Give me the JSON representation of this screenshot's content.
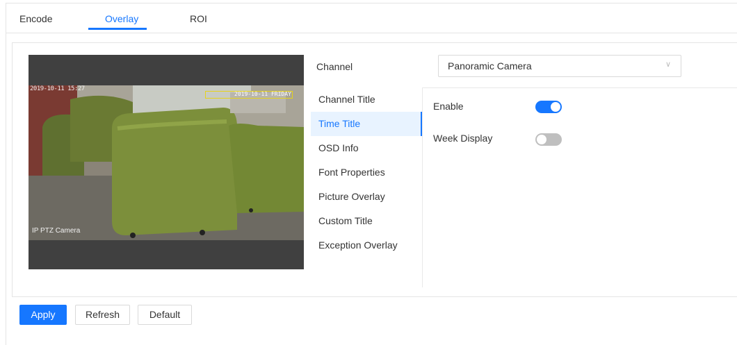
{
  "tabs": [
    {
      "label": "Encode"
    },
    {
      "label": "Overlay"
    },
    {
      "label": "ROI"
    }
  ],
  "video": {
    "osd_time": "2019-10-11 15:27",
    "osd_channel_name": "IP PTZ Camera",
    "roi_text": "2019-10-11 FRIDAY"
  },
  "channel": {
    "label": "Channel",
    "selected": "Panoramic Camera"
  },
  "menu": {
    "items": [
      {
        "label": "Channel Title"
      },
      {
        "label": "Time Title"
      },
      {
        "label": "OSD Info"
      },
      {
        "label": "Font Properties"
      },
      {
        "label": "Picture Overlay"
      },
      {
        "label": "Custom Title"
      },
      {
        "label": "Exception Overlay"
      }
    ],
    "active_index": 1
  },
  "settings": {
    "enable_label": "Enable",
    "enable_on": true,
    "week_display_label": "Week Display",
    "week_display_on": false
  },
  "buttons": {
    "apply": "Apply",
    "refresh": "Refresh",
    "default": "Default"
  },
  "colors": {
    "accent": "#1677ff",
    "toggle_off": "#bfbfbf",
    "roi_box": "#e6d31c"
  }
}
